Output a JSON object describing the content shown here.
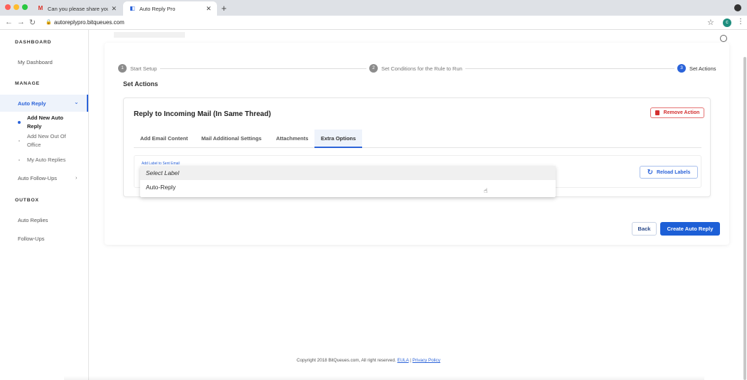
{
  "browser": {
    "tabs": [
      {
        "title": "Can you please share your me",
        "icon": "gmail-icon",
        "active": false
      },
      {
        "title": "Auto Reply Pro",
        "icon": "app-icon",
        "active": true
      }
    ],
    "url": "autoreplypro.bitqueues.com",
    "profile_initial": "c"
  },
  "sidebar": {
    "dashboard_head": "DASHBOARD",
    "my_dashboard": "My Dashboard",
    "manage_head": "MANAGE",
    "auto_reply": "Auto Reply",
    "sub_items": [
      {
        "label": "Add New Auto Reply",
        "active": true
      },
      {
        "label": "Add New Out Of Office",
        "active": false
      },
      {
        "label": "My Auto Replies",
        "active": false
      }
    ],
    "auto_follow_ups": "Auto Follow-Ups",
    "outbox_head": "OUTBOX",
    "auto_replies": "Auto Replies",
    "follow_ups": "Follow-Ups"
  },
  "stepper": {
    "steps": [
      {
        "num": "1",
        "label": "Start Setup"
      },
      {
        "num": "2",
        "label": "Set Conditions for the Rule to Run"
      },
      {
        "num": "3",
        "label": "Set Actions"
      }
    ]
  },
  "main": {
    "section_title": "Set Actions",
    "action_title": "Reply to Incoming Mail (In Same Thread)",
    "remove_action": "Remove Action",
    "tabs": [
      "Add Email Content",
      "Mail Additional Settings",
      "Attachments",
      "Extra Options"
    ],
    "selected_tab": "Extra Options",
    "field_label": "Add Label to Sent Email",
    "reload_labels": "Reload Labels",
    "dropdown": {
      "placeholder": "Select Label",
      "options": [
        "Auto-Reply"
      ]
    },
    "back": "Back",
    "create": "Create Auto Reply"
  },
  "footer": {
    "copyright": "Copyright 2018 BitQueues.com, All right reserved.",
    "eula": "EULA",
    "separator": "|",
    "privacy": "Privacy Policy"
  },
  "colors": {
    "accent": "#2b63d9",
    "danger": "#d32f2f",
    "primary_button": "#1d5fd6"
  }
}
